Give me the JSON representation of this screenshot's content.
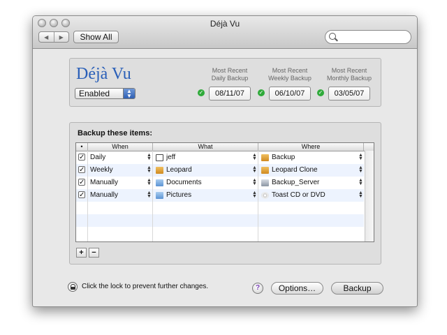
{
  "window": {
    "title": "Déjà Vu"
  },
  "toolbar": {
    "show_all_label": "Show All",
    "back_glyph": "◀",
    "forward_glyph": "▶"
  },
  "app": {
    "name": "Déjà Vu",
    "status": "Enabled",
    "backups": [
      {
        "label_line1": "Most Recent",
        "label_line2": "Daily Backup",
        "date": "08/11/07"
      },
      {
        "label_line1": "Most Recent",
        "label_line2": "Weekly Backup",
        "date": "06/10/07"
      },
      {
        "label_line1": "Most Recent",
        "label_line2": "Monthly Backup",
        "date": "03/05/07"
      }
    ]
  },
  "items": {
    "heading": "Backup these items:",
    "columns": {
      "check": "•",
      "when": "When",
      "what": "What",
      "where": "Where"
    },
    "rows": [
      {
        "checked": true,
        "when": "Daily",
        "what": "jeff",
        "what_icon": "home-icon",
        "where": "Backup",
        "where_icon": "drive-icon"
      },
      {
        "checked": true,
        "when": "Weekly",
        "what": "Leopard",
        "what_icon": "drive-icon",
        "where": "Leopard Clone",
        "where_icon": "drive-icon"
      },
      {
        "checked": true,
        "when": "Manually",
        "what": "Documents",
        "what_icon": "folder-icon",
        "where": "Backup_Server",
        "where_icon": "server-icon"
      },
      {
        "checked": true,
        "when": "Manually",
        "what": "Pictures",
        "what_icon": "folder-icon",
        "where": "Toast CD or DVD",
        "where_icon": "disc-icon"
      }
    ],
    "add_label": "+",
    "remove_label": "−"
  },
  "footer": {
    "lock_text": "Click the lock to prevent further changes.",
    "help_label": "?",
    "options_label": "Options…",
    "backup_label": "Backup"
  },
  "colors": {
    "title_blue": "#2a5fb8",
    "check_green": "#2faa3a",
    "row_alt": "#edf3fe"
  }
}
